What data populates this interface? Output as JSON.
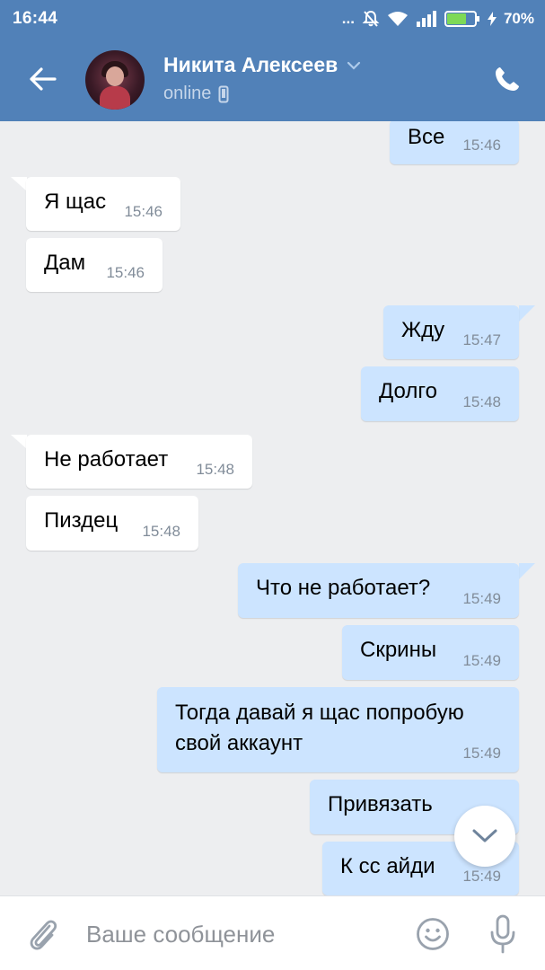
{
  "status_bar": {
    "time": "16:44",
    "dots": "...",
    "battery_percent": "70%",
    "battery_level": 0.7
  },
  "header": {
    "contact_name": "Никита Алексеев",
    "status": "online"
  },
  "messages": [
    {
      "direction": "out",
      "text": "Все",
      "time": "15:46"
    },
    {
      "direction": "in",
      "text": "Я щас",
      "time": "15:46"
    },
    {
      "direction": "in",
      "text": "Дам",
      "time": "15:46"
    },
    {
      "direction": "out",
      "text": "Жду",
      "time": "15:47"
    },
    {
      "direction": "out",
      "text": "Долго",
      "time": "15:48"
    },
    {
      "direction": "in",
      "text": "Не работает",
      "time": "15:48"
    },
    {
      "direction": "in",
      "text": "Пиздец",
      "time": "15:48"
    },
    {
      "direction": "out",
      "text": "Что не работает?",
      "time": "15:49"
    },
    {
      "direction": "out",
      "text": "Скрины",
      "time": "15:49"
    },
    {
      "direction": "out",
      "text": "Тогда давай я щас попробую свой аккаунт",
      "time": "15:49"
    },
    {
      "direction": "out",
      "text": "Привязать",
      "time": ""
    },
    {
      "direction": "out",
      "text": "К сс айди",
      "time": "15:49"
    }
  ],
  "composer": {
    "placeholder": "Ваше сообщение"
  },
  "colors": {
    "header": "#5181b8",
    "outgoing_bubble": "#cce4ff",
    "incoming_bubble": "#ffffff",
    "background": "#edeef0"
  }
}
